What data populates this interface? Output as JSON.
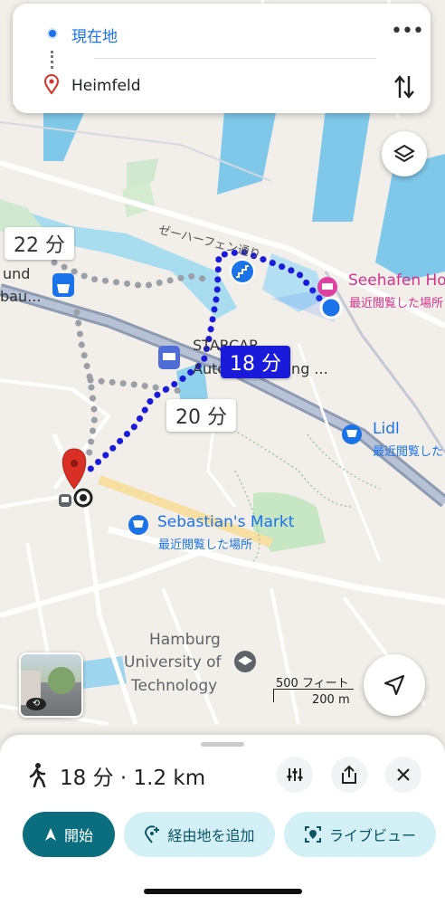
{
  "search": {
    "origin": "現在地",
    "destination": "Heimfeld",
    "more_icon": "more-vert-icon",
    "swap_icon": "swap-vert-icon"
  },
  "map": {
    "layers_icon": "layers-icon",
    "street_label": "ゼーハーフェン通り",
    "place_seehafen": "Seehafen Ho",
    "place_seehafen_sub": "最近閲覧した場所",
    "place_starcar_1": "STARCAR",
    "place_starcar_2": "Autovermietung ...",
    "place_lidl": "Lidl",
    "place_lidl_sub": "最近閲覧した",
    "place_sebastian": "Sebastian's Markt",
    "place_sebastian_sub": "最近閲覧した場所",
    "place_left_1": "und",
    "place_left_2": "bau...",
    "university": [
      "Hamburg",
      "University of",
      "Technology"
    ],
    "time_main": "18 分",
    "time_alt1": "22 分",
    "time_alt2": "20 分",
    "scale_ft": "500 フィート",
    "scale_m": "200 m",
    "location_icon": "navigation-arrow-icon"
  },
  "sheet": {
    "summary": "18 分 · 1.2 km",
    "walk_icon": "walking-person-icon",
    "start_label": "開始",
    "add_stop_label": "経由地を追加",
    "live_view_label": "ライブビュー"
  },
  "colors": {
    "route": "#1a1adb",
    "accent": "#0b6e7f",
    "chip_bg": "#d3f0f7",
    "destination": "#d93025"
  }
}
